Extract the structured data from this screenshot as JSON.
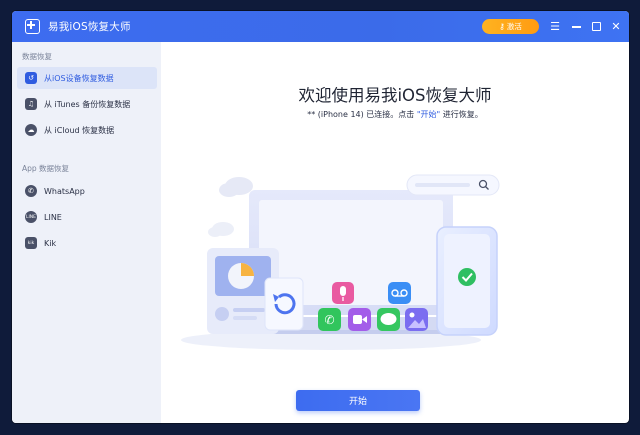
{
  "window": {
    "title": "易我iOS恢复大师",
    "activate_label": "激活",
    "activate_color": "#ff9f14",
    "accent_color": "#3d6cf0"
  },
  "sidebar": {
    "section1_label": "数据恢复",
    "items": [
      {
        "label": "从iOS设备恢复数据",
        "icon": "phone-restore-icon",
        "active": true
      },
      {
        "label": "从 iTunes 备份恢复数据",
        "icon": "itunes-music-icon",
        "active": false
      },
      {
        "label": "从 iCloud 恢复数据",
        "icon": "icloud-icon",
        "active": false
      }
    ],
    "section2_label": "App 数据恢复",
    "apps": [
      {
        "label": "WhatsApp",
        "icon": "whatsapp-icon"
      },
      {
        "label": "LINE",
        "icon": "line-icon",
        "icon_text": "LINE"
      },
      {
        "label": "Kik",
        "icon": "kik-icon",
        "icon_text": "kik"
      }
    ]
  },
  "main": {
    "heading": "欢迎使用易我iOS恢复大师",
    "status_prefix": "** (iPhone 14) 已连接。点击 ",
    "status_highlight": "\"开始\"",
    "status_suffix": " 进行恢复。",
    "start_label": "开始"
  }
}
